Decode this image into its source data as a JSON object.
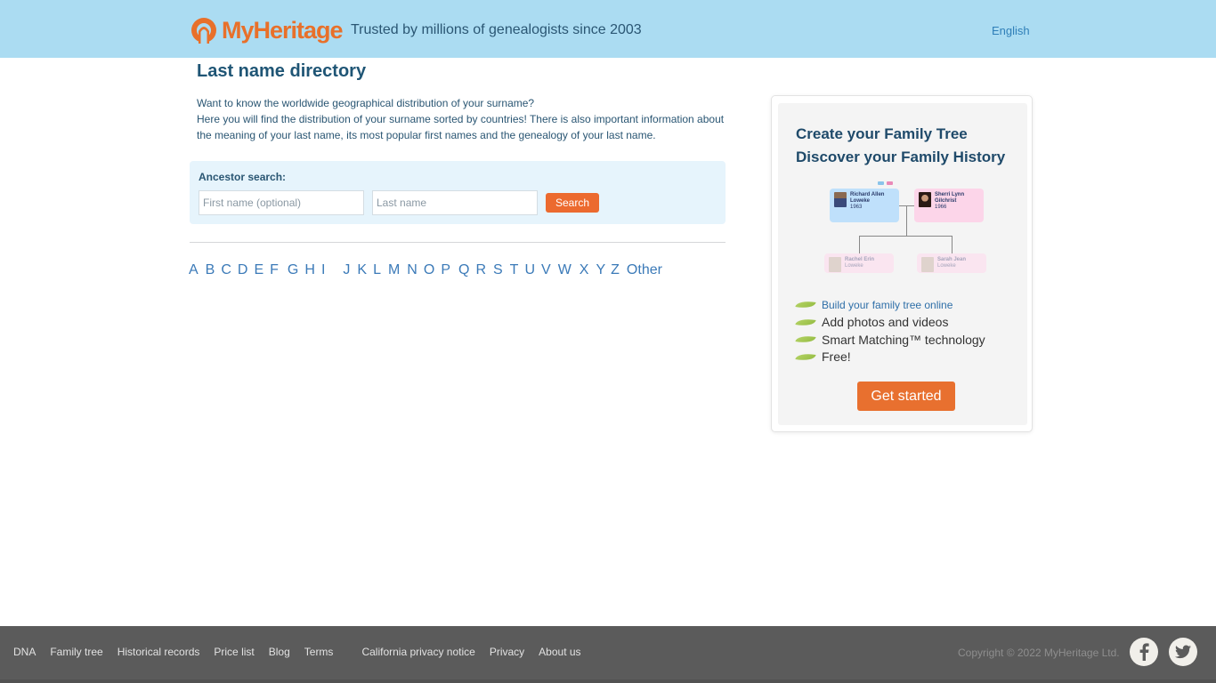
{
  "header": {
    "logo_text": "MyHeritage",
    "tagline": "Trusted by millions of genealogists since 2003",
    "language": "English"
  },
  "main": {
    "title": "Last name directory",
    "intro_line1": "Want to know the worldwide geographical distribution of your surname?",
    "intro_line2": "Here you will find the distribution of your surname sorted by countries! There is also important information about the meaning of your last name, its most popular first names and the genealogy of your last name.",
    "search": {
      "label": "Ancestor search:",
      "first_name_placeholder": "First name (optional)",
      "first_name_value": "",
      "last_name_placeholder": "Last name",
      "last_name_value": "",
      "button_label": "Search"
    },
    "alphabet": [
      "A",
      "B",
      "C",
      "D",
      "E",
      "F",
      "G",
      "H",
      "I",
      "J",
      "K",
      "L",
      "M",
      "N",
      "O",
      "P",
      "Q",
      "R",
      "S",
      "T",
      "U",
      "V",
      "W",
      "X",
      "Y",
      "Z",
      "Other"
    ]
  },
  "promo": {
    "title_line1": "Create your Family Tree",
    "title_line2": "Discover your Family History",
    "tree": {
      "father": {
        "name_line1": "Richard Allen",
        "name_line2": "Loweke",
        "year": "1963"
      },
      "mother": {
        "name_line1": "Sherri Lynn",
        "name_line2": "Gilchrist",
        "year": "1966"
      },
      "child1": {
        "name_line1": "Rachel Erin",
        "name_line2": "Loweke"
      },
      "child2": {
        "name_line1": "Sarah Jean",
        "name_line2": "Loweke"
      }
    },
    "features": [
      "Build your family tree online",
      "Add photos and videos",
      "Smart Matching™ technology",
      "Free!"
    ],
    "cta_label": "Get started",
    "colors": {
      "accent": "#e8702f",
      "leaf": "#a3c650"
    }
  },
  "footer": {
    "links": [
      "DNA",
      "Family tree",
      "Historical records",
      "Price list",
      "Blog",
      "Terms",
      "California privacy notice",
      "Privacy",
      "About us"
    ],
    "copyright": "Copyright © 2022 MyHeritage Ltd.",
    "social": [
      "facebook-icon",
      "twitter-icon"
    ]
  },
  "colors": {
    "header_bg": "#abdcf2",
    "brand_orange": "#e8702a",
    "footer_bg": "#5b5b5b",
    "link_blue": "#3b7ab8"
  }
}
